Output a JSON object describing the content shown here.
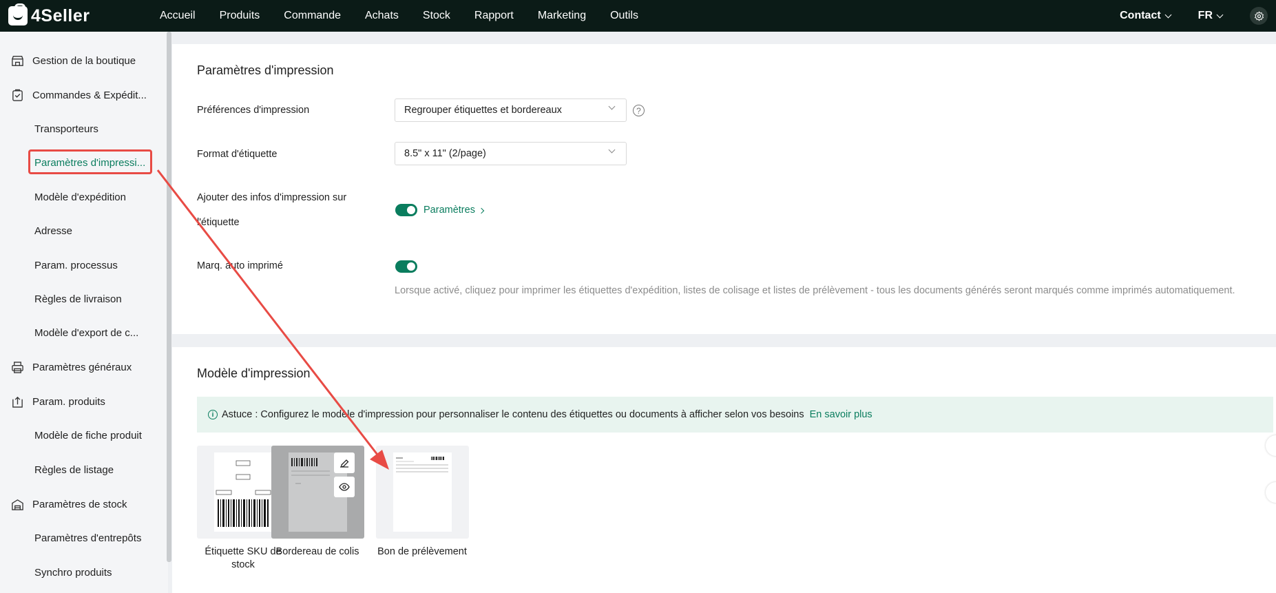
{
  "brand": {
    "name": "4Seller"
  },
  "nav": [
    "Accueil",
    "Produits",
    "Commande",
    "Achats",
    "Stock",
    "Rapport",
    "Marketing",
    "Outils"
  ],
  "topbar": {
    "contact": "Contact",
    "lang": "FR"
  },
  "sidebar": {
    "items": [
      {
        "label": "Gestion de la boutique",
        "icon": "shop-icon",
        "level": "top"
      },
      {
        "label": "Commandes & Expédit...",
        "icon": "clipboard-icon",
        "level": "top"
      },
      {
        "label": "Transporteurs",
        "level": "sub"
      },
      {
        "label": "Paramètres d'impressi...",
        "level": "sub",
        "active": true
      },
      {
        "label": "Modèle d'expédition",
        "level": "sub"
      },
      {
        "label": "Adresse",
        "level": "sub"
      },
      {
        "label": "Param. processus",
        "level": "sub"
      },
      {
        "label": "Règles de livraison",
        "level": "sub"
      },
      {
        "label": "Modèle d'export de c...",
        "level": "sub"
      },
      {
        "label": "Paramètres généraux",
        "icon": "printer-icon",
        "level": "top"
      },
      {
        "label": "Param. produits",
        "icon": "upload-box-icon",
        "level": "top"
      },
      {
        "label": "Modèle de fiche produit",
        "level": "sub"
      },
      {
        "label": "Règles de listage",
        "level": "sub"
      },
      {
        "label": "Paramètres de stock",
        "icon": "warehouse-icon",
        "level": "top"
      },
      {
        "label": "Paramètres d'entrepôts",
        "level": "sub"
      },
      {
        "label": "Synchro produits",
        "level": "sub"
      }
    ]
  },
  "print_settings": {
    "title": "Paramètres d'impression",
    "pref_label": "Préférences d'impression",
    "pref_value": "Regrouper étiquettes et bordereaux",
    "format_label": "Format d'étiquette",
    "format_value": "8.5\" x 11\" (2/page)",
    "addinfo_label_1": "Ajouter des infos d'impression sur",
    "addinfo_label_2": "l'étiquette",
    "addinfo_enabled": true,
    "addinfo_link": "Paramètres",
    "automark_label": "Marq. auto imprimé",
    "automark_enabled": true,
    "automark_desc": "Lorsque activé, cliquez pour imprimer les étiquettes d'expédition, listes de colisage et listes de prélèvement - tous les documents générés seront marqués comme imprimés automatiquement."
  },
  "print_template": {
    "title": "Modèle d'impression",
    "tip_text": "Astuce : Configurez le modèle d'impression pour personnaliser le contenu des étiquettes ou documents à afficher selon vos besoins",
    "tip_link": "En savoir plus",
    "templates": [
      {
        "name_1": "Étiquette SKU de",
        "name_2": "stock"
      },
      {
        "name_1": "Bordereau de colis",
        "name_2": ""
      },
      {
        "name_1": "Bon de prélèvement",
        "name_2": ""
      }
    ]
  },
  "colors": {
    "accent": "#0a7d5e",
    "annotation": "#e84b45",
    "topbar": "#0b1b17"
  }
}
